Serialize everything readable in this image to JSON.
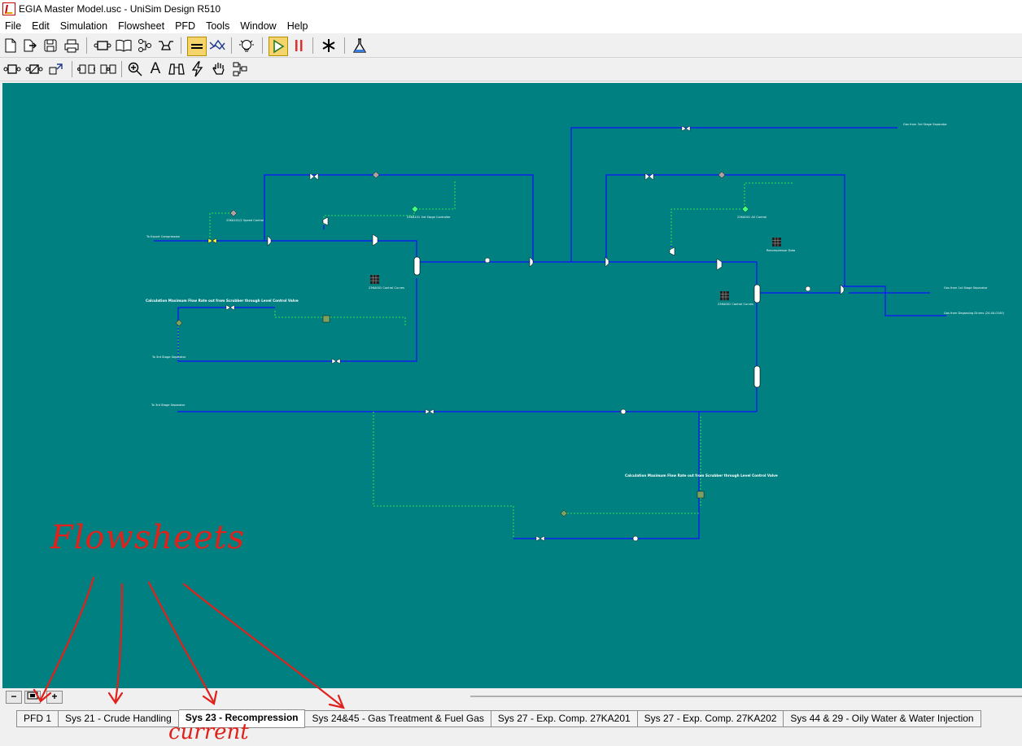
{
  "window": {
    "title": "EGIA Master Model.usc - UniSim Design R510"
  },
  "menu": [
    "File",
    "Edit",
    "Simulation",
    "Flowsheet",
    "PFD",
    "Tools",
    "Window",
    "Help"
  ],
  "toolbar1": [
    "new-icon",
    "open-icon",
    "save-icon",
    "print-icon",
    "workbook-icon",
    "book-icon",
    "tree-icon",
    "pfd-icon",
    "equation-icon",
    "lightbulb-icon",
    "play-icon",
    "pause-icon",
    "snowflake-icon",
    "flask-icon"
  ],
  "toolbar2": [
    "attach-icon",
    "break-icon",
    "auto-position-icon",
    "swap-icon",
    "link-icon",
    "zoom-icon",
    "text-icon",
    "binoculars-icon",
    "bolt-icon",
    "hand-icon",
    "cascade-icon"
  ],
  "pfd": {
    "calc_note_left": "Calculation Maximum Flow Rate out from Scrubber through Level Control Valve",
    "calc_note_right": "Calculation Maximum Flow Rate out from Scrubber through Level Control Valve",
    "labels": {
      "gas_from_3rd_stage": "Gas from 3rd Stage Separator",
      "gas_from_1st_stage": "Gas from 1st Stage Separator",
      "gas_from_degassing": "Gas from Degassing Drums (24-VA-0100)",
      "to_export": "To Export Compression",
      "to_3rd_stage_a": "To 3rd Stage Separator",
      "to_3rd_stage_b": "To 3rd Stage Separator",
      "recompressor_data": "Recompressor Data",
      "control_a": "23KA001 Control Curves",
      "control_b": "23KA001 Control Curves",
      "speed_control": "23KA101/2 Speed Control",
      "stage_controller": "23KA101 3rd Stage Controller",
      "asv_control": "23KA001 AS Control"
    }
  },
  "bottom": {
    "tabs": [
      {
        "label": "PFD 1",
        "active": false
      },
      {
        "label": "Sys 21 - Crude Handling",
        "active": false
      },
      {
        "label": "Sys 23 - Recompression",
        "active": true
      },
      {
        "label": "Sys 24&45 - Gas Treatment & Fuel Gas",
        "active": false
      },
      {
        "label": "Sys 27 - Exp. Comp. 27KA201",
        "active": false
      },
      {
        "label": "Sys 27 - Exp. Comp. 27KA202",
        "active": false
      },
      {
        "label": "Sys 44 & 29 - Oily Water & Water Injection",
        "active": false
      }
    ]
  },
  "annotations": {
    "flowsheets": "Flowsheets",
    "current": "current"
  },
  "colors": {
    "canvas": "#008080",
    "stream": "#1010ff",
    "signal": "#40ff40",
    "annotation": "#e0201a"
  }
}
